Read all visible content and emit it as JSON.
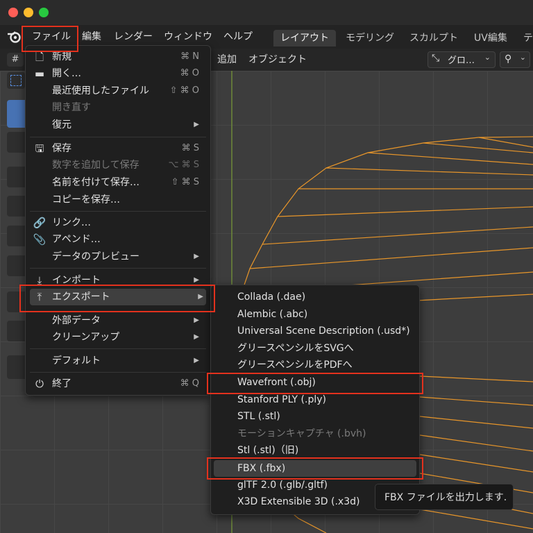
{
  "window": {
    "traffic_lights": {
      "close": "#ff5f57",
      "minimize": "#febc2e",
      "zoom": "#28c840"
    }
  },
  "menubar": {
    "logo_icon": "blender-logo-icon",
    "items": [
      "ファイル",
      "編集",
      "レンダー",
      "ウィンドウ",
      "ヘルプ"
    ]
  },
  "workspaces": {
    "tabs": [
      "レイアウト",
      "モデリング",
      "スカルプト",
      "UV編集",
      "テ"
    ],
    "active": "レイアウト"
  },
  "header": {
    "menu_add": "追加",
    "menu_object": "オブジェクト",
    "transform_orientation": "グロ…"
  },
  "file_menu": {
    "new": {
      "label": "新規",
      "shortcut": "⌘ N",
      "icon": "new-file-icon"
    },
    "open": {
      "label": "開く…",
      "shortcut": "⌘ O",
      "icon": "folder-icon"
    },
    "recent": {
      "label": "最近使用したファイル",
      "shortcut": "⇧ ⌘ O"
    },
    "revert": {
      "label": "開き直す"
    },
    "recover": {
      "label": "復元"
    },
    "save": {
      "label": "保存",
      "shortcut": "⌘ S",
      "icon": "save-icon"
    },
    "save_incremental": {
      "label": "数字を追加して保存",
      "shortcut": "⌥ ⌘ S"
    },
    "save_as": {
      "label": "名前を付けて保存…",
      "shortcut": "⇧ ⌘ S"
    },
    "save_copy": {
      "label": "コピーを保存…"
    },
    "link": {
      "label": "リンク…",
      "icon": "link-icon"
    },
    "append": {
      "label": "アペンド…",
      "icon": "append-icon"
    },
    "data_preview": {
      "label": "データのプレビュー"
    },
    "import": {
      "label": "インポート",
      "icon": "import-icon"
    },
    "export": {
      "label": "エクスポート",
      "icon": "export-icon"
    },
    "external_data": {
      "label": "外部データ"
    },
    "cleanup": {
      "label": "クリーンアップ"
    },
    "defaults": {
      "label": "デフォルト"
    },
    "quit": {
      "label": "終了",
      "shortcut": "⌘ Q",
      "icon": "power-icon"
    },
    "submenu_arrow": "▶"
  },
  "export_menu": {
    "items": [
      "Collada (.dae)",
      "Alembic (.abc)",
      "Universal Scene Description (.usd*)",
      "グリースペンシルをSVGへ",
      "グリースペンシルをPDFへ",
      "Wavefront (.obj)",
      "Stanford PLY (.ply)",
      "STL (.stl)",
      "モーションキャプチャ (.bvh)",
      "Stl (.stl)（旧)",
      "FBX (.fbx)",
      "glTF 2.0 (.glb/.gltf)",
      "X3D Extensible 3D (.x3d)"
    ],
    "disabled_index": 8,
    "highlighted_index": 10
  },
  "tooltip": {
    "text": "FBX ファイルを出力します."
  },
  "colors": {
    "accent_red": "#e3311d",
    "wire_orange": "#e8962a",
    "selection_blue": "#4772b3"
  }
}
